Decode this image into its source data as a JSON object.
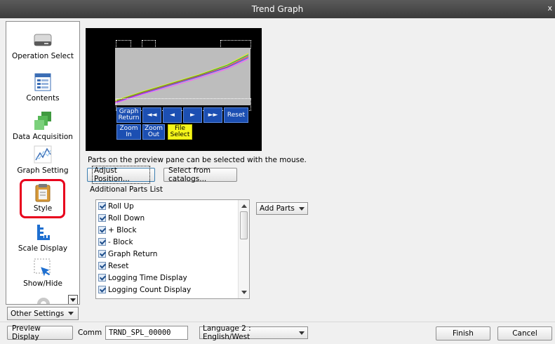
{
  "window": {
    "title": "Trend Graph",
    "close_label": "x"
  },
  "sidebar": {
    "items": [
      {
        "label": "Operation Select"
      },
      {
        "label": "Contents"
      },
      {
        "label": "Data Acquisition"
      },
      {
        "label": "Graph Setting"
      },
      {
        "label": "Style",
        "selected": true
      },
      {
        "label": "Scale Display"
      },
      {
        "label": "Show/Hide"
      }
    ],
    "other_settings": "Other Settings"
  },
  "preview": {
    "buttons": {
      "graph_return": "Graph Return",
      "rew": "◄◄",
      "back": "◄",
      "fwd": "►",
      "ffwd": "►►",
      "reset": "Reset",
      "zoom_in": "Zoom In",
      "zoom_out": "Zoom Out",
      "file_select": "File Select"
    },
    "colors": {
      "buttons": "#1c4fb2",
      "file_select": "#f5f51a",
      "graph_bg": "#bdbdbd"
    }
  },
  "main": {
    "hint": "Parts on the preview pane can be selected with the mouse.",
    "adjust_position": "Adjust Position...",
    "select_from_catalogs": "Select from catalogs...",
    "additional_parts_title": "Additional Parts List",
    "add_parts": "Add Parts",
    "parts": [
      {
        "label": "Roll Up",
        "checked": true
      },
      {
        "label": "Roll Down",
        "checked": true
      },
      {
        "label": "+ Block",
        "checked": true
      },
      {
        "label": "- Block",
        "checked": true
      },
      {
        "label": "Graph Return",
        "checked": true
      },
      {
        "label": "Reset",
        "checked": true
      },
      {
        "label": "Logging Time Display",
        "checked": true
      },
      {
        "label": "Logging Count Display",
        "checked": true
      }
    ]
  },
  "bottom": {
    "preview_display": "Preview Display",
    "comm_label": "Comm",
    "comm_value": "TRND_SPL_00000",
    "language": "Language 2 : English/West",
    "finish": "Finish",
    "cancel": "Cancel"
  },
  "highlight_color": "#e8001c"
}
